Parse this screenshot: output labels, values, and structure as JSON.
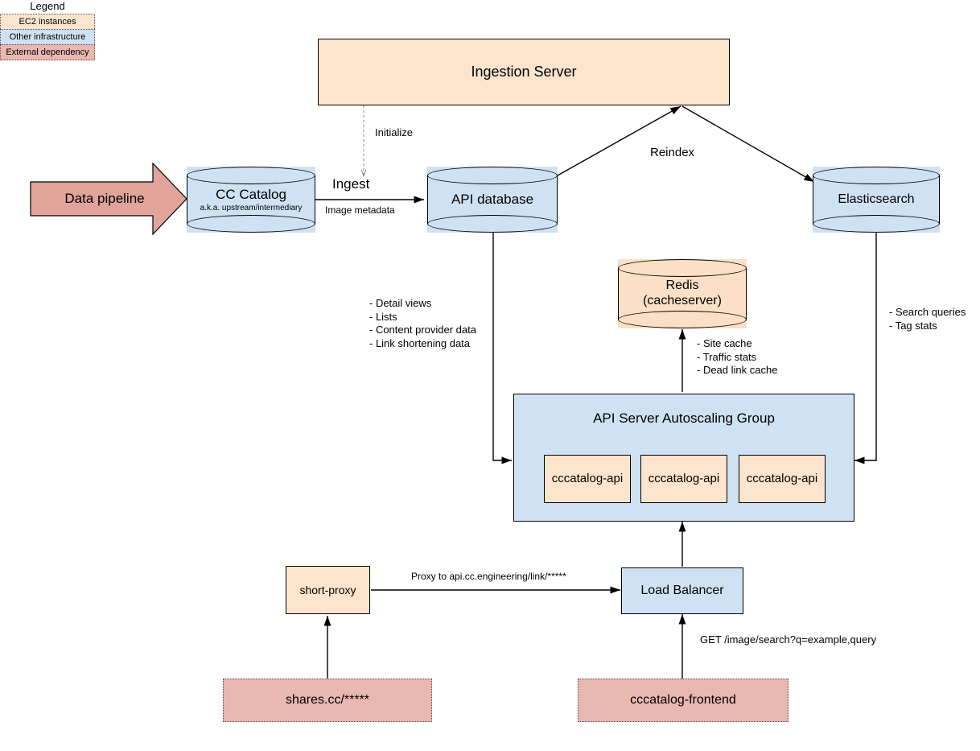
{
  "legend": {
    "title": "Legend",
    "items": [
      {
        "label": "EC2 instances",
        "color": "#fce4cd"
      },
      {
        "label": "Other infrastructure",
        "color": "#cfe2f3"
      },
      {
        "label": "External dependency",
        "color": "#e9b8b0"
      }
    ]
  },
  "nodes": {
    "data_pipeline": {
      "label": "Data pipeline"
    },
    "cc_catalog": {
      "label": "CC Catalog",
      "subtitle": "a.k.a. upstream/intermediary"
    },
    "ingestion_server": {
      "label": "Ingestion Server"
    },
    "api_database": {
      "label": "API database"
    },
    "elasticsearch": {
      "label": "Elasticsearch"
    },
    "redis": {
      "label": "Redis",
      "label2": "(cacheserver)"
    },
    "asg": {
      "label": "API Server Autoscaling Group"
    },
    "api_instance_1": {
      "label": "cccatalog-api"
    },
    "api_instance_2": {
      "label": "cccatalog-api"
    },
    "api_instance_3": {
      "label": "cccatalog-api"
    },
    "short_proxy": {
      "label": "short-proxy"
    },
    "load_balancer": {
      "label": "Load Balancer"
    },
    "shares_cc": {
      "label": "shares.cc/*****"
    },
    "cccatalog_frontend": {
      "label": "cccatalog-frontend"
    }
  },
  "edge_labels": {
    "initialize": "Initialize",
    "ingest": "Ingest",
    "image_metadata": "Image metadata",
    "reindex": "Reindex",
    "api_db_usage": "- Detail views\n- Lists\n- Content provider data\n- Link shortening data",
    "redis_usage": "- Site cache\n- Traffic stats\n- Dead link cache",
    "elasticsearch_usage": "- Search queries\n- Tag stats",
    "proxy_link": "Proxy to api.cc.engineering/link/*****",
    "get_search": "GET /image/search?q=example,query"
  },
  "colors": {
    "ec2": "#fce4cd",
    "infrastructure": "#cfe2f3",
    "external": "#e9b8b0",
    "cylinder_orange": "#fbe0c5",
    "stroke": "#000000",
    "external_stroke": "#555555"
  }
}
